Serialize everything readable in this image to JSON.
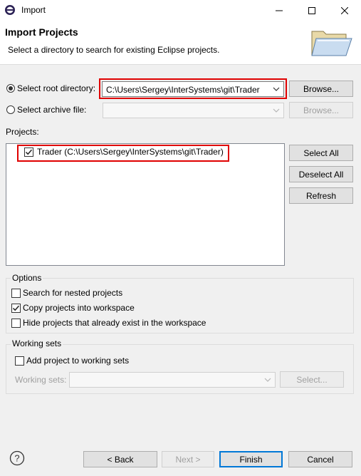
{
  "window": {
    "title": "Import",
    "icon": "eclipse-icon"
  },
  "header": {
    "title": "Import Projects",
    "description": "Select a directory to search for existing Eclipse projects.",
    "graphic": "open-folder-icon"
  },
  "source": {
    "root_directory": {
      "label": "Select root directory:",
      "selected": true,
      "value": "C:\\Users\\Sergey\\InterSystems\\git\\Trader",
      "browse_label": "Browse..."
    },
    "archive_file": {
      "label": "Select archive file:",
      "selected": false,
      "value": "",
      "browse_label": "Browse..."
    }
  },
  "projects": {
    "label": "Projects:",
    "items": [
      {
        "label": "Trader (C:\\Users\\Sergey\\InterSystems\\git\\Trader)",
        "checked": true
      }
    ],
    "select_all_label": "Select All",
    "deselect_all_label": "Deselect All",
    "refresh_label": "Refresh"
  },
  "options": {
    "label": "Options",
    "search_nested": {
      "label": "Search for nested projects",
      "checked": false
    },
    "copy_into_workspace": {
      "label": "Copy projects into workspace",
      "checked": true
    },
    "hide_existing": {
      "label": "Hide projects that already exist in the workspace",
      "checked": false
    }
  },
  "working_sets": {
    "label": "Working sets",
    "add_to_sets": {
      "label": "Add project to working sets",
      "checked": false
    },
    "sets_label": "Working sets:",
    "sets_value": "",
    "select_label": "Select..."
  },
  "footer": {
    "help_icon": "help-icon",
    "back_label": "< Back",
    "next_label": "Next >",
    "finish_label": "Finish",
    "cancel_label": "Cancel"
  },
  "colors": {
    "highlight": "#e00000",
    "focus_border": "#0078d7"
  }
}
